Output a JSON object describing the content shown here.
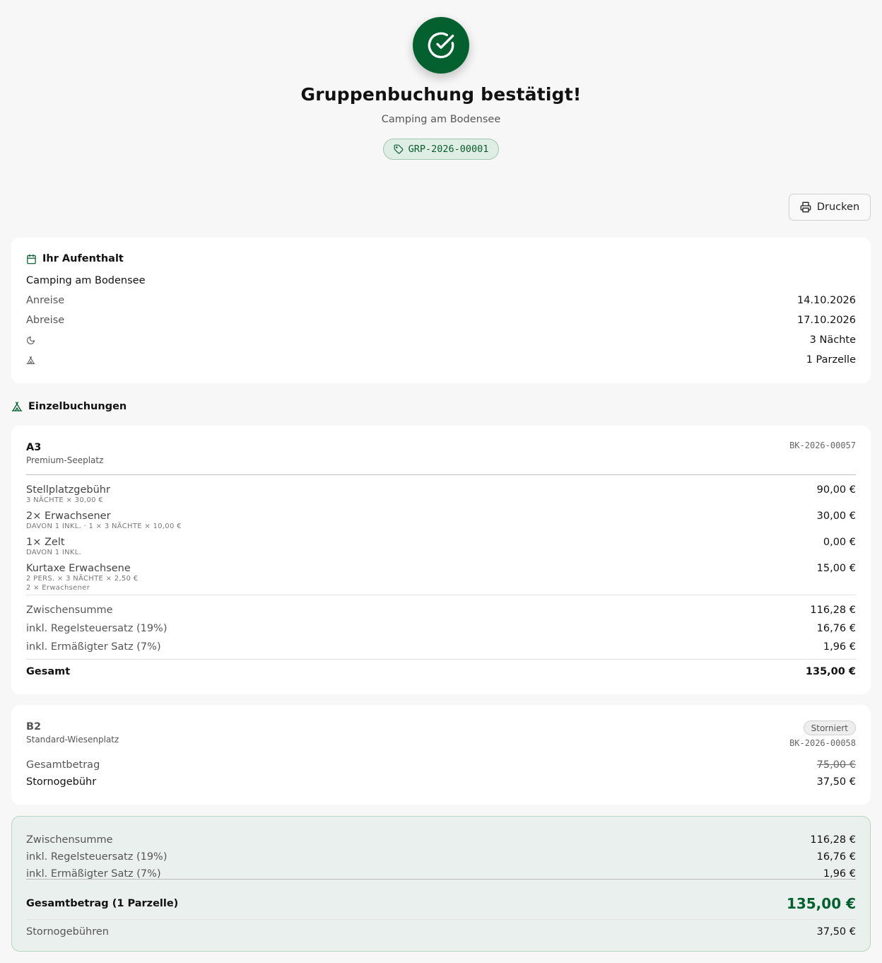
{
  "hero": {
    "title": "Gruppenbuchung bestätigt!",
    "subtitle": "Camping am Bodensee",
    "group_ref": "GRP-2026-00001",
    "accent": "#04602f"
  },
  "toolbar": {
    "print_label": "Drucken",
    "print_icon": "printer-icon"
  },
  "stay": {
    "heading": "Ihr Aufenthalt",
    "heading_icon": "calendar-icon",
    "site_name": "Camping am Bodensee",
    "arrival_label": "Anreise",
    "arrival_value": "14.10.2026",
    "departure_label": "Abreise",
    "departure_value": "17.10.2026",
    "nights_icon": "moon-icon",
    "nights_value": "3 Nächte",
    "plots_icon": "tent-icon",
    "plots_value": "1 Parzelle"
  },
  "bookings_heading": "Einzelbuchungen",
  "bookings": [
    {
      "plot": "A3",
      "plot_type": "Premium-Seeplatz",
      "code": "BK-2026-00057",
      "items": [
        {
          "name": "Stellplatzgebühr",
          "sub": "3 NÄCHTE × 30,00 €",
          "sub2": "",
          "amount": "90,00 €"
        },
        {
          "name": "2× Erwachsener",
          "sub": "DAVON 1 INKL. · 1 × 3 NÄCHTE × 10,00 €",
          "sub2": "",
          "amount": "30,00 €"
        },
        {
          "name": "1× Zelt",
          "sub": "DAVON 1 INKL.",
          "sub2": "",
          "amount": "0,00 €"
        },
        {
          "name": "Kurtaxe Erwachsene",
          "sub": "2 PERS. × 3 NÄCHTE × 2,50 €",
          "sub2": "2 × Erwachsener",
          "amount": "15,00 €"
        }
      ],
      "subtotal_label": "Zwischensumme",
      "subtotal": "116,28 €",
      "vat19_label": "inkl. Regelsteuersatz (19%)",
      "vat19": "16,76 €",
      "vat7_label": "inkl. Ermäßigter Satz (7%)",
      "vat7": "1,96 €",
      "total_label": "Gesamt",
      "total": "135,00 €"
    },
    {
      "plot": "B2",
      "plot_type": "Standard-Wiesenplatz",
      "status": "Storniert",
      "code": "BK-2026-00058",
      "amount_label": "Gesamtbetrag",
      "amount": "75,00 €",
      "fee_label": "Stornogebühr",
      "fee": "37,50 €"
    }
  ],
  "summary": {
    "subtotal_label": "Zwischensumme",
    "subtotal": "116,28 €",
    "vat19_label": "inkl. Regelsteuersatz (19%)",
    "vat19": "16,76 €",
    "vat7_label": "inkl. Ermäßigter Satz (7%)",
    "vat7": "1,96 €",
    "grand_label": "Gesamtbetrag (1 Parzelle)",
    "grand_total": "135,00 €",
    "cancel_label": "Stornogebühren",
    "cancel_total": "37,50 €"
  }
}
